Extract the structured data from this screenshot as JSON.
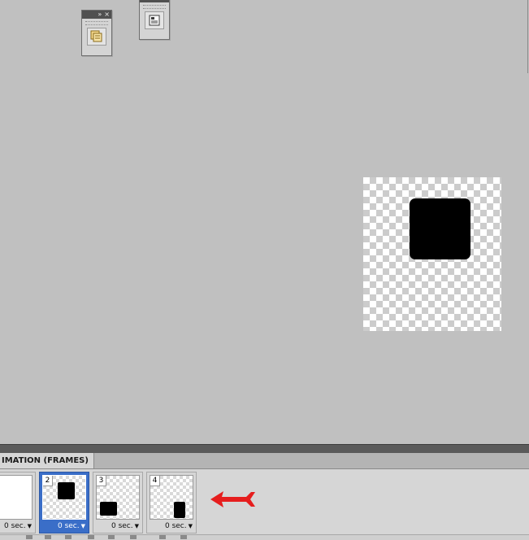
{
  "panels": {
    "mini_panel_1": {
      "controls": [
        "»",
        "×"
      ],
      "icon": "history-icon"
    },
    "mini_panel_2": {
      "icon": "document-info-icon"
    }
  },
  "document": {
    "shape": "rounded-black-square"
  },
  "animation_panel": {
    "tab_label": "IMATION (FRAMES)",
    "frames": [
      {
        "number": "",
        "delay": "0 sec.",
        "selected": false
      },
      {
        "number": "2",
        "delay": "0 sec.",
        "selected": true
      },
      {
        "number": "3",
        "delay": "0 sec.",
        "selected": false
      },
      {
        "number": "4",
        "delay": "0 sec.",
        "selected": false
      }
    ],
    "dropdown_glyph": "▼"
  },
  "annotation": {
    "icon": "red-arrow-icon",
    "color": "#e61e1e"
  }
}
